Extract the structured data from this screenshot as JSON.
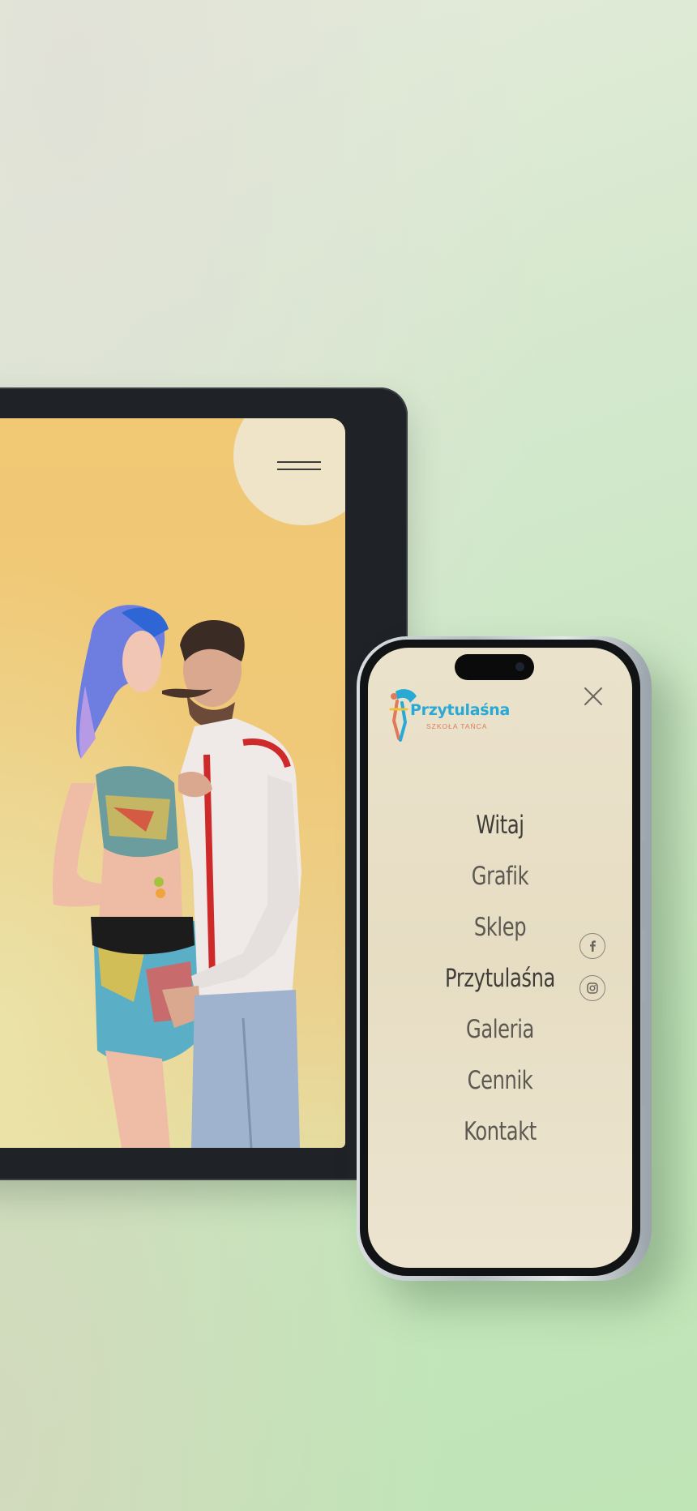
{
  "colors": {
    "brand_blue": "#29a9d6",
    "brand_orange": "#e07a5a",
    "menu_text": "#5c5852",
    "tablet_bg": "#f1c874",
    "phone_bg": "#ebe2cc"
  },
  "tablet": {
    "menu_icon": "hamburger-menu-icon"
  },
  "phone": {
    "logo": {
      "name": "Przytulaśna",
      "subtitle": "SZKOŁA TAŃCA"
    },
    "close_icon": "close-icon",
    "nav": [
      {
        "label": "Witaj"
      },
      {
        "label": "Grafik"
      },
      {
        "label": "Sklep"
      },
      {
        "label": "Przytulaśna"
      },
      {
        "label": "Galeria"
      },
      {
        "label": "Cennik"
      },
      {
        "label": "Kontakt"
      }
    ],
    "social": [
      {
        "icon": "facebook-icon"
      },
      {
        "icon": "instagram-icon"
      }
    ]
  }
}
